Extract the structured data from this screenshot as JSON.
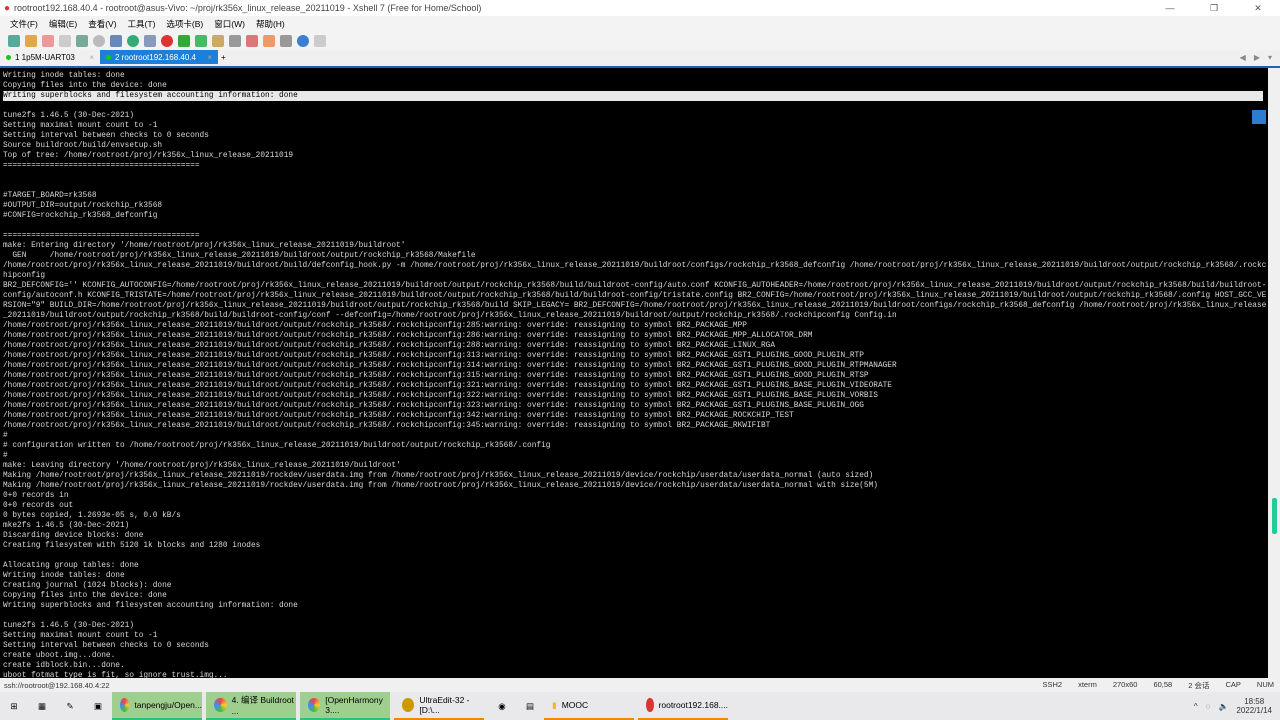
{
  "window": {
    "title": "rootroot192.168.40.4 - rootroot@asus-Vivo: ~/proj/rk356x_linux_release_20211019 - Xshell 7 (Free for Home/School)"
  },
  "menu": [
    "文件(F)",
    "编辑(E)",
    "查看(V)",
    "工具(T)",
    "选项卡(B)",
    "窗口(W)",
    "帮助(H)"
  ],
  "tabs": [
    {
      "label": "1 1p5M-UART03"
    },
    {
      "label": "2 rootroot192.168.40.4"
    }
  ],
  "new_tab": "+",
  "terminal": {
    "lines": [
      "Writing inode tables: done",
      "Copying files into the device: done",
      "Writing superblocks and filesystem accounting information: done",
      "",
      "tune2fs 1.46.5 (30-Dec-2021)",
      "Setting maximal mount count to -1",
      "Setting interval between checks to 0 seconds",
      "Source buildroot/build/envsetup.sh",
      "Top of tree: /home/rootroot/proj/rk356x_linux_release_20211019",
      "==========================================",
      "",
      "",
      "#TARGET_BOARD=rk3568",
      "#OUTPUT_DIR=output/rockchip_rk3568",
      "#CONFIG=rockchip_rk3568_defconfig",
      "",
      "==========================================",
      "make: Entering directory '/home/rootroot/proj/rk356x_linux_release_20211019/buildroot'",
      "  GEN     /home/rootroot/proj/rk356x_linux_release_20211019/buildroot/output/rockchip_rk3568/Makefile",
      "/home/rootroot/proj/rk356x_linux_release_20211019/buildroot/build/defconfig_hook.py -m /home/rootroot/proj/rk356x_linux_release_20211019/buildroot/configs/rockchip_rk3568_defconfig /home/rootroot/proj/rk356x_linux_release_20211019/buildroot/output/rockchip_rk3568/.rockc",
      "hipconfig",
      "BR2_DEFCONFIG='' KCONFIG_AUTOCONFIG=/home/rootroot/proj/rk356x_linux_release_20211019/buildroot/output/rockchip_rk3568/build/buildroot-config/auto.conf KCONFIG_AUTOHEADER=/home/rootroot/proj/rk356x_linux_release_20211019/buildroot/output/rockchip_rk3568/build/buildroot-",
      "config/autoconf.h KCONFIG_TRISTATE=/home/rootroot/proj/rk356x_linux_release_20211019/buildroot/output/rockchip_rk3568/build/buildroot-config/tristate.config BR2_CONFIG=/home/rootroot/proj/rk356x_linux_release_20211019/buildroot/output/rockchip_rk3568/.config HOST_GCC_VE",
      "RSION=\"9\" BUILD_DIR=/home/rootroot/proj/rk356x_linux_release_20211019/buildroot/output/rockchip_rk3568/build SKIP_LEGACY= BR2_DEFCONFIG=/home/rootroot/proj/rk356x_linux_release_20211019/buildroot/configs/rockchip_rk3568_defconfig /home/rootroot/proj/rk356x_linux_release",
      "_20211019/buildroot/output/rockchip_rk3568/build/buildroot-config/conf --defconfig=/home/rootroot/proj/rk356x_linux_release_20211019/buildroot/output/rockchip_rk3568/.rockchipconfig Config.in",
      "/home/rootroot/proj/rk356x_linux_release_20211019/buildroot/output/rockchip_rk3568/.rockchipconfig:285:warning: override: reassigning to symbol BR2_PACKAGE_MPP",
      "/home/rootroot/proj/rk356x_linux_release_20211019/buildroot/output/rockchip_rk3568/.rockchipconfig:286:warning: override: reassigning to symbol BR2_PACKAGE_MPP_ALLOCATOR_DRM",
      "/home/rootroot/proj/rk356x_linux_release_20211019/buildroot/output/rockchip_rk3568/.rockchipconfig:288:warning: override: reassigning to symbol BR2_PACKAGE_LINUX_RGA",
      "/home/rootroot/proj/rk356x_linux_release_20211019/buildroot/output/rockchip_rk3568/.rockchipconfig:313:warning: override: reassigning to symbol BR2_PACKAGE_GST1_PLUGINS_GOOD_PLUGIN_RTP",
      "/home/rootroot/proj/rk356x_linux_release_20211019/buildroot/output/rockchip_rk3568/.rockchipconfig:314:warning: override: reassigning to symbol BR2_PACKAGE_GST1_PLUGINS_GOOD_PLUGIN_RTPMANAGER",
      "/home/rootroot/proj/rk356x_linux_release_20211019/buildroot/output/rockchip_rk3568/.rockchipconfig:315:warning: override: reassigning to symbol BR2_PACKAGE_GST1_PLUGINS_GOOD_PLUGIN_RTSP",
      "/home/rootroot/proj/rk356x_linux_release_20211019/buildroot/output/rockchip_rk3568/.rockchipconfig:321:warning: override: reassigning to symbol BR2_PACKAGE_GST1_PLUGINS_BASE_PLUGIN_VIDEORATE",
      "/home/rootroot/proj/rk356x_linux_release_20211019/buildroot/output/rockchip_rk3568/.rockchipconfig:322:warning: override: reassigning to symbol BR2_PACKAGE_GST1_PLUGINS_BASE_PLUGIN_VORBIS",
      "/home/rootroot/proj/rk356x_linux_release_20211019/buildroot/output/rockchip_rk3568/.rockchipconfig:323:warning: override: reassigning to symbol BR2_PACKAGE_GST1_PLUGINS_BASE_PLUGIN_OGG",
      "/home/rootroot/proj/rk356x_linux_release_20211019/buildroot/output/rockchip_rk3568/.rockchipconfig:342:warning: override: reassigning to symbol BR2_PACKAGE_ROCKCHIP_TEST",
      "/home/rootroot/proj/rk356x_linux_release_20211019/buildroot/output/rockchip_rk3568/.rockchipconfig:345:warning: override: reassigning to symbol BR2_PACKAGE_RKWIFIBT",
      "#",
      "# configuration written to /home/rootroot/proj/rk356x_linux_release_20211019/buildroot/output/rockchip_rk3568/.config",
      "#",
      "make: Leaving directory '/home/rootroot/proj/rk356x_linux_release_20211019/buildroot'",
      "Making /home/rootroot/proj/rk356x_linux_release_20211019/rockdev/userdata.img from /home/rootroot/proj/rk356x_linux_release_20211019/device/rockchip/userdata/userdata_normal (auto sized)",
      "Making /home/rootroot/proj/rk356x_linux_release_20211019/rockdev/userdata.img from /home/rootroot/proj/rk356x_linux_release_20211019/device/rockchip/userdata/userdata_normal with size(5M)",
      "0+0 records in",
      "0+0 records out",
      "0 bytes copied, 1.2693e-05 s, 0.0 kB/s",
      "mke2fs 1.46.5 (30-Dec-2021)",
      "Discarding device blocks: done",
      "Creating filesystem with 5120 1k blocks and 1280 inodes",
      "",
      "Allocating group tables: done",
      "Writing inode tables: done",
      "Creating journal (1024 blocks): done",
      "Copying files into the device: done",
      "Writing superblocks and filesystem accounting information: done",
      "",
      "tune2fs 1.46.5 (30-Dec-2021)",
      "Setting maximal mount count to -1",
      "Setting interval between checks to 0 seconds",
      "create uboot.img...done.",
      "create idblock.bin...done.",
      "uboot fotmat type is fit, so ignore trust.img..."
    ],
    "highlight_index": 2
  },
  "status": {
    "connection": "ssh://rootroot@192.168.40.4:22",
    "protocol": "SSH2",
    "term": "xterm",
    "size": "270x60",
    "cursor": "60,58",
    "sessions": "2 会话",
    "cap": "CAP",
    "num": "NUM"
  },
  "taskbar": {
    "apps": [
      "tanpengju/Open...",
      "4. 编译 Buildroot ...",
      "[OpenHarmony 3....",
      "UltraEdit-32 - [D:\\...",
      "MOOC",
      "rootroot192.168...."
    ],
    "time": "18:58",
    "date": "2022/1/14"
  }
}
